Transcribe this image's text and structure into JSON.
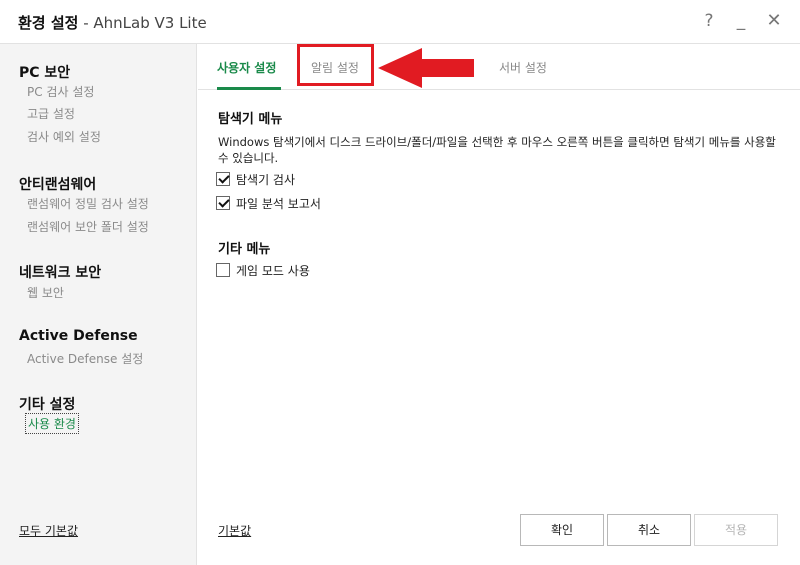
{
  "window": {
    "title_bold": "환경 설정",
    "title_rest": " - AhnLab V3 Lite",
    "help": "?",
    "minimize": "_",
    "close": "✕"
  },
  "sidebar": {
    "sections": [
      {
        "title": "PC 보안",
        "items": [
          "PC 검사 설정",
          "고급 설정",
          "검사 예외 설정"
        ]
      },
      {
        "title": "안티랜섬웨어",
        "items": [
          "랜섬웨어 정밀 검사 설정",
          "랜섬웨어 보안 폴더 설정"
        ]
      },
      {
        "title": "네트워크 보안",
        "items": [
          "웹 보안"
        ]
      },
      {
        "title": "Active Defense",
        "items": [
          "Active Defense 설정"
        ]
      },
      {
        "title": "기타 설정",
        "items": [
          "사용 환경"
        ]
      }
    ],
    "active_item": "사용 환경",
    "reset_all": "모두 기본값"
  },
  "tabs": [
    {
      "label": "사용자 설정",
      "active": true
    },
    {
      "label": "알림 설정",
      "active": false
    },
    {
      "label": "서버 설정",
      "active": false
    }
  ],
  "explorer_menu": {
    "title": "탐색기 메뉴",
    "description": "Windows 탐색기에서 디스크 드라이브/폴더/파일을 선택한 후 마우스 오른쪽 버튼을 클릭하면 탐색기 메뉴를 사용할 수 있습니다.",
    "options": [
      {
        "label": "탐색기 검사",
        "checked": true
      },
      {
        "label": "파일 분석 보고서",
        "checked": true
      }
    ]
  },
  "other_menu": {
    "title": "기타 메뉴",
    "options": [
      {
        "label": "게임 모드 사용",
        "checked": false
      }
    ]
  },
  "footer": {
    "reset": "기본값",
    "ok": "확인",
    "cancel": "취소",
    "apply": "적용"
  },
  "colors": {
    "accent": "#1a8a4a",
    "highlight": "#e11b22"
  }
}
